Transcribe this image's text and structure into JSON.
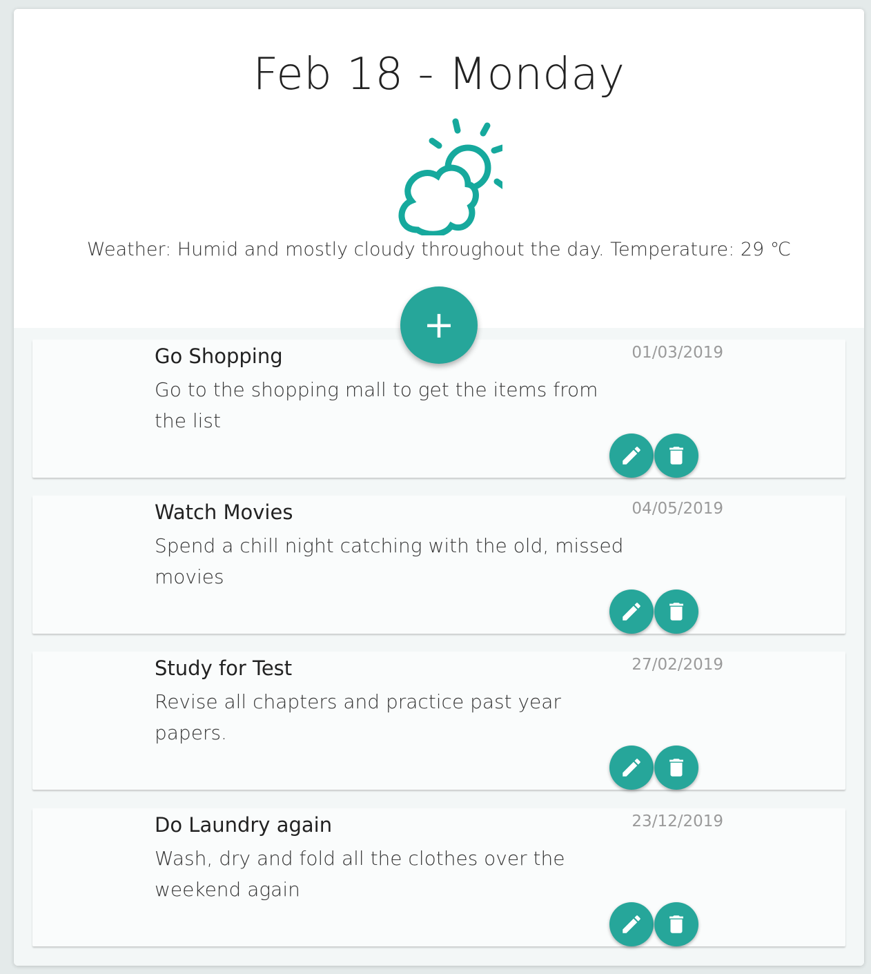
{
  "header": {
    "date_title": "Feb 18 - Monday",
    "weather_icon": "partly-cloudy-icon",
    "weather_text": "Weather: Humid and mostly cloudy throughout the day. Temperature: 29 ℃"
  },
  "add_button": {
    "label": "+",
    "icon": "plus-icon"
  },
  "tasks": [
    {
      "title": "Go Shopping",
      "description": "Go to the shopping mall to get the items from the list",
      "date": "01/03/2019"
    },
    {
      "title": "Watch Movies",
      "description": "Spend a chill night catching with the old, missed movies",
      "date": "04/05/2019"
    },
    {
      "title": "Study for Test",
      "description": "Revise all chapters and practice past year papers.",
      "date": "27/02/2019"
    },
    {
      "title": "Do Laundry again",
      "description": "Wash, dry and fold all the clothes over the weekend again",
      "date": "23/12/2019"
    }
  ],
  "icons": {
    "edit": "pencil-icon",
    "delete": "trash-icon"
  },
  "colors": {
    "accent": "#26a69a",
    "background": "#f3f7f7",
    "card": "#fafcfc"
  }
}
